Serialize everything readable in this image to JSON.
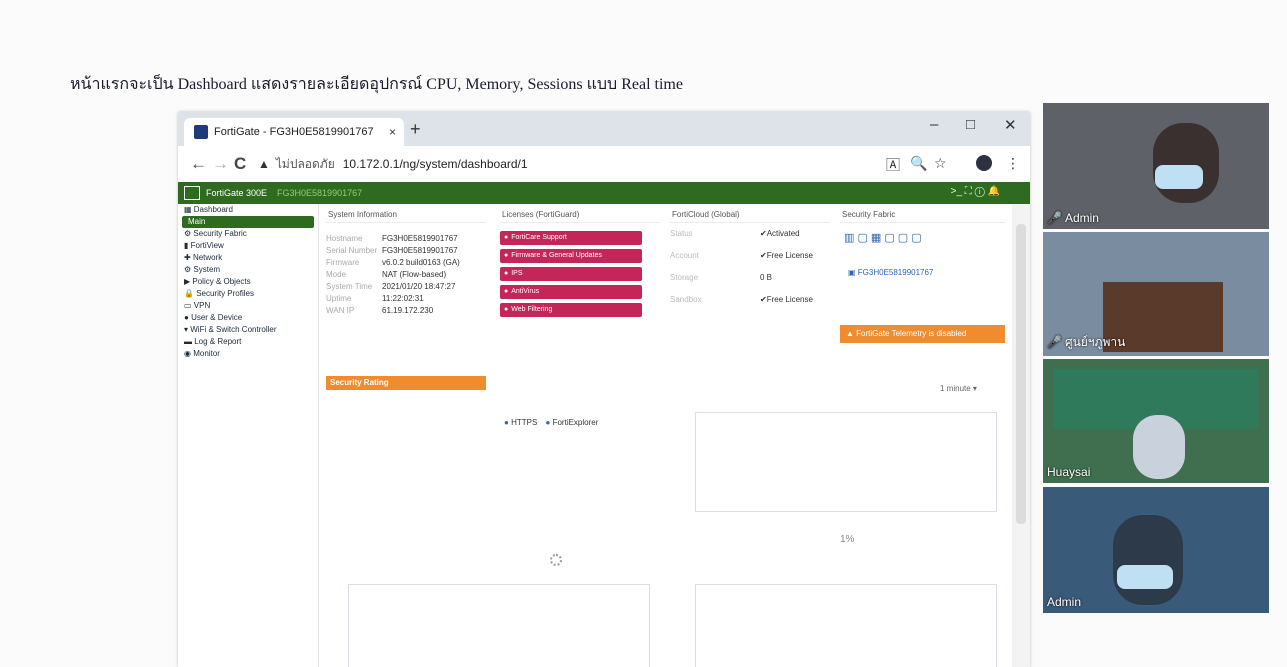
{
  "caption": "หน้าแรกจะเป็น Dashboard แสดงรายละเอียดอุปกรณ์ CPU, Memory, Sessions แบบ Real time",
  "browser": {
    "tab_title": "FortiGate - FG3H0E5819901767",
    "tab_close": "×",
    "new_tab": "+",
    "minimize": "–",
    "maximize": "□",
    "close": "✕",
    "back": "←",
    "forward": "→",
    "reload": "C",
    "security_label": "ไม่ปลอดภัย",
    "url": "10.172.0.1/ng/system/dashboard/1",
    "translate": "🄰",
    "zoom": "🔍",
    "star": "☆",
    "menu": "⋮"
  },
  "fortigate": {
    "product": "FortiGate 300E",
    "serial": "FG3H0E5819901767",
    "header_icons": ">_   ⛶   ⓘ   🔔"
  },
  "sidebar": {
    "items": [
      {
        "label": "Dashboard",
        "icon": "dashboard-icon"
      },
      {
        "label": "Main",
        "icon": ""
      },
      {
        "label": "Security Fabric",
        "icon": "fabric-icon"
      },
      {
        "label": "FortiView",
        "icon": "fortiview-icon"
      },
      {
        "label": "Network",
        "icon": "network-icon"
      },
      {
        "label": "System",
        "icon": "gear-icon"
      },
      {
        "label": "Policy & Objects",
        "icon": "policy-icon"
      },
      {
        "label": "Security Profiles",
        "icon": "lock-icon"
      },
      {
        "label": "VPN",
        "icon": "vpn-icon"
      },
      {
        "label": "User & Device",
        "icon": "user-icon"
      },
      {
        "label": "WiFi & Switch Controller",
        "icon": "wifi-icon"
      },
      {
        "label": "Log & Report",
        "icon": "chart-icon"
      },
      {
        "label": "Monitor",
        "icon": "monitor-icon"
      }
    ]
  },
  "widgets": {
    "system_info": {
      "title": "System Information",
      "rows": [
        {
          "key": "Hostname",
          "value": "FG3H0E5819901767"
        },
        {
          "key": "Serial Number",
          "value": "FG3H0E5819901767"
        },
        {
          "key": "Firmware",
          "value": "v6.0.2 build0163 (GA)"
        },
        {
          "key": "Mode",
          "value": "NAT (Flow-based)"
        },
        {
          "key": "System Time",
          "value": "2021/01/20 18:47:27"
        },
        {
          "key": "Uptime",
          "value": "11:22:02:31"
        },
        {
          "key": "WAN IP",
          "value": "61.19.172.230"
        }
      ]
    },
    "licenses": {
      "title": "Licenses (FortiGuard)",
      "items": [
        "FortiCare Support",
        "Firmware & General Updates",
        "IPS",
        "AntiVirus",
        "Web Filtering"
      ]
    },
    "forticloud": {
      "title": "FortiCloud (Global)",
      "rows": [
        {
          "key": "Status",
          "value": "Activated"
        },
        {
          "key": "Account",
          "value": "Free License"
        },
        {
          "key": "Storage",
          "value": "0 B"
        },
        {
          "key": "Sandbox",
          "value": "Free License"
        }
      ]
    },
    "security_fabric": {
      "title": "Security Fabric",
      "device": "FG3H0E5819901767",
      "telemetry": "FortiGate Telemetry is disabled"
    },
    "security_rating": {
      "title": "Security Rating"
    },
    "legend": {
      "item1": "HTTPS",
      "item2": "FortiExplorer"
    },
    "chart_controls": {
      "interval": "1 minute ▾"
    },
    "cpu_percent": "1%"
  },
  "videos": [
    {
      "name": "Admin"
    },
    {
      "name": "ศูนย์ฯภูพาน"
    },
    {
      "name": "Huaysai"
    },
    {
      "name": "Admin"
    }
  ]
}
